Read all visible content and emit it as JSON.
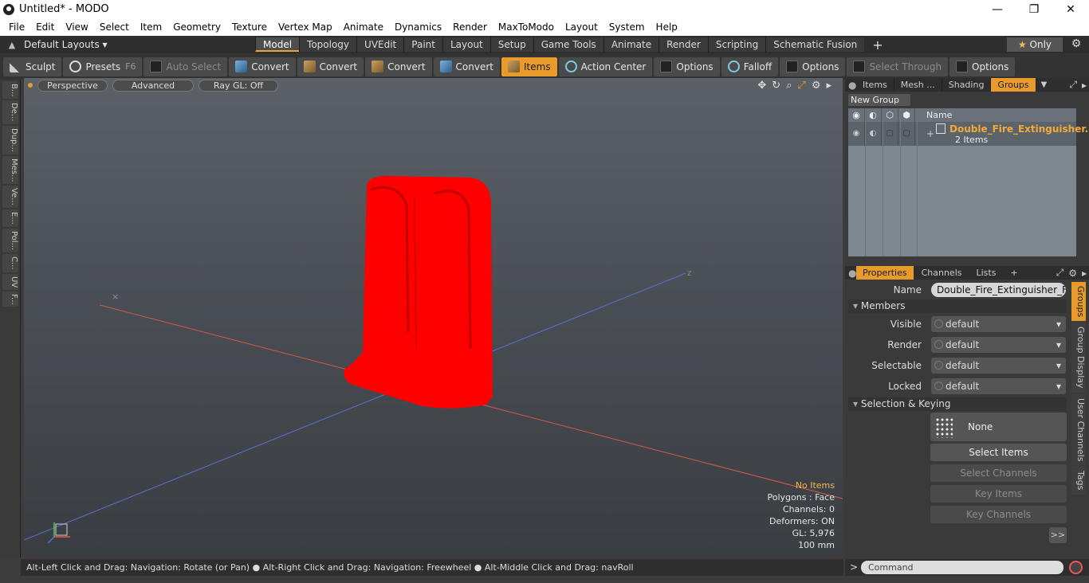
{
  "window": {
    "title": "Untitled* - MODO",
    "minimize": "—",
    "restore": "❐",
    "close": "✕"
  },
  "menu": [
    "File",
    "Edit",
    "View",
    "Select",
    "Item",
    "Geometry",
    "Texture",
    "Vertex Map",
    "Animate",
    "Dynamics",
    "Render",
    "MaxToModo",
    "Layout",
    "System",
    "Help"
  ],
  "layoutbar": {
    "layouts_label": "Default Layouts ▾",
    "tabs": [
      "Model",
      "Topology",
      "UVEdit",
      "Paint",
      "Layout",
      "Setup",
      "Game Tools",
      "Animate",
      "Render",
      "Scripting",
      "Schematic Fusion"
    ],
    "active_tab": "Model",
    "plus": "+",
    "only_label": "Only",
    "star": "★",
    "gear": "⚙"
  },
  "toolbar": {
    "sculpt": "Sculpt",
    "presets": "Presets",
    "presets_key": "F6",
    "auto_select": "Auto Select",
    "convert1": "Convert",
    "convert2": "Convert",
    "convert3": "Convert",
    "convert4": "Convert",
    "items": "Items",
    "action_center": "Action Center",
    "options1": "Options",
    "falloff": "Falloff",
    "options2": "Options",
    "select_through": "Select Through",
    "options3": "Options"
  },
  "leftbar": [
    "B...",
    "De...",
    "Dup...",
    "Mes...",
    "Ve...",
    "E...",
    "Pol...",
    "C...",
    "UV",
    "F..."
  ],
  "viewport": {
    "perspective": "Perspective",
    "advanced": "Advanced",
    "raygl": "Ray GL: Off",
    "stats": {
      "selection": "No Items",
      "polygons": "Polygons : Face",
      "channels": "Channels: 0",
      "deformers": "Deformers: ON",
      "gl": "GL: 5,976",
      "scale": "100 mm"
    },
    "icons": [
      "move-icon",
      "rotate-icon",
      "zoom-icon",
      "fit-icon",
      "gear-icon",
      "arrow-icon"
    ]
  },
  "status": "Alt-Left Click and Drag: Navigation: Rotate (or Pan) ● Alt-Right Click and Drag: Navigation: Freewheel ● Alt-Middle Click and Drag: navRoll",
  "groups_panel": {
    "tabs": [
      "Items",
      "Mesh ...",
      "Shading",
      "Groups"
    ],
    "active_tab": "Groups",
    "new_group": "New Group",
    "name_header": "Name",
    "group_name": "Double_Fire_Extinguisher...",
    "group_count": "2 Items"
  },
  "properties": {
    "tabs": [
      "Properties",
      "Channels",
      "Lists"
    ],
    "active_tab": "Properties",
    "plus": "+",
    "name_label": "Name",
    "name_value": "Double_Fire_Extinguisher_Fiberg",
    "members_header": "Members",
    "visible_label": "Visible",
    "visible_value": "default",
    "render_label": "Render",
    "render_value": "default",
    "selectable_label": "Selectable",
    "selectable_value": "default",
    "locked_label": "Locked",
    "locked_value": "default",
    "sel_keying_header": "Selection & Keying",
    "none_label": "None",
    "select_items": "Select Items",
    "select_channels": "Select Channels",
    "key_items": "Key Items",
    "key_channels": "Key Channels",
    "expand": ">>",
    "vtabs": [
      "Groups",
      "Group Display",
      "User Channels",
      "Tags"
    ]
  },
  "command": {
    "prompt": ">",
    "placeholder": "Command"
  },
  "colors": {
    "accent": "#e89b2b",
    "object": "#ff0000",
    "x_axis": "#e05a4a",
    "z_axis": "#5a6fd0"
  }
}
